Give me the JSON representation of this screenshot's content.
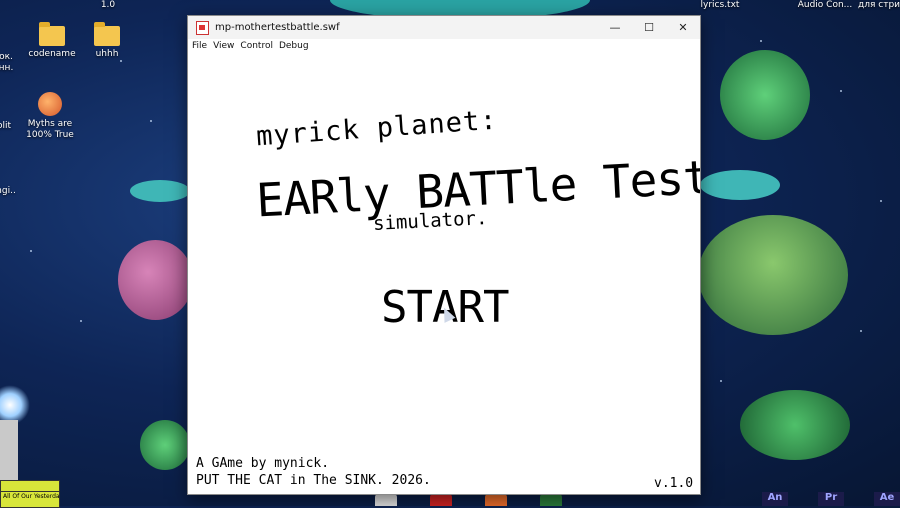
{
  "desktop": {
    "top_labels": {
      "left": "1.0",
      "right1": "lyrics.txt",
      "right2": "Audio Con...",
      "right3": "для стри"
    },
    "icons": [
      {
        "label": "codename"
      },
      {
        "label": "uhhh"
      },
      {
        "label": "Myths are 100% True"
      }
    ],
    "edge_labels": [
      "ок.",
      "нн.",
      "olit",
      "ngi.."
    ],
    "music_widget": "All Of Our Yesterda"
  },
  "window": {
    "title": "mp-mothertestbattle.swf",
    "menu": [
      "File",
      "View",
      "Control",
      "Debug"
    ],
    "controls": {
      "minimize": "—",
      "maximize": "☐",
      "close": "✕"
    }
  },
  "game": {
    "title_line1": "myrick planet:",
    "title_line2": "EARly BATTle Test!",
    "subtitle": "simulator.",
    "start_label": "START",
    "credit_line1": "A GAme by mynick.",
    "credit_line2": "PUT THE CAT in The SINK. 2026.",
    "version": "v.1.0"
  },
  "taskbar": {
    "adobe_labels": [
      "An",
      "Pr",
      "Ae"
    ]
  }
}
